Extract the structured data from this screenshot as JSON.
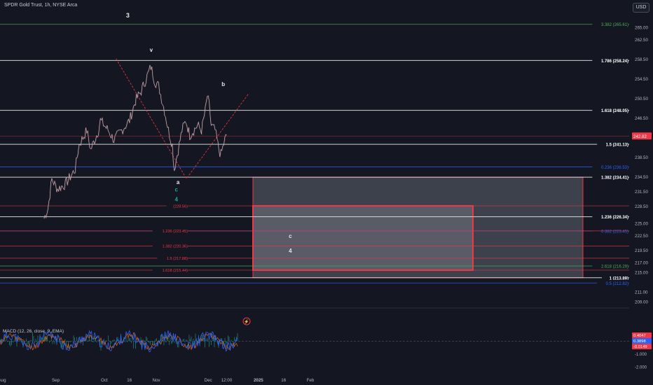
{
  "header": {
    "title": "SPDR Gold Trust, 1h, NYSE Arca",
    "currency": "USD"
  },
  "chart_data": {
    "type": "line",
    "y_axis": {
      "ticks": [
        "265.00",
        "262.50",
        "258.50",
        "254.50",
        "250.50",
        "246.50",
        "238.50",
        "234.50",
        "231.50",
        "228.50",
        "225.00",
        "222.50",
        "219.50",
        "217.00",
        "215.00",
        "211.00",
        "209.00"
      ],
      "current_price": "242.82",
      "range": [
        208,
        268
      ]
    },
    "x_axis": {
      "ticks": [
        "Aug",
        "Sep",
        "Oct",
        "16",
        "Nov",
        "Dec",
        "12:00",
        "2025",
        "16",
        "Feb"
      ]
    },
    "price_path": {
      "date_range": [
        "2024-08-26",
        "2024-12-20"
      ],
      "points": [
        [
          0,
          226
        ],
        [
          2,
          228
        ],
        [
          4,
          234
        ],
        [
          7,
          232
        ],
        [
          11,
          233
        ],
        [
          16,
          236
        ],
        [
          18,
          241
        ],
        [
          22,
          244
        ],
        [
          24,
          240
        ],
        [
          28,
          244
        ],
        [
          29,
          246
        ],
        [
          33,
          244
        ],
        [
          36,
          242
        ],
        [
          40,
          244
        ],
        [
          44,
          246
        ],
        [
          47,
          250
        ],
        [
          50,
          252
        ],
        [
          53,
          255
        ],
        [
          55,
          257
        ],
        [
          57,
          254
        ],
        [
          59,
          253
        ],
        [
          62,
          248
        ],
        [
          64,
          244
        ],
        [
          66,
          241
        ],
        [
          67,
          236
        ],
        [
          69,
          240
        ],
        [
          71,
          244
        ],
        [
          73,
          246
        ],
        [
          75,
          243
        ],
        [
          77,
          244
        ],
        [
          79,
          245
        ],
        [
          81,
          244
        ],
        [
          83,
          248
        ],
        [
          84,
          251
        ],
        [
          85,
          249
        ],
        [
          86,
          245
        ],
        [
          88,
          244
        ],
        [
          90,
          240
        ],
        [
          91,
          239
        ],
        [
          93,
          242
        ],
        [
          94,
          243
        ]
      ]
    },
    "price_levels": [
      {
        "label": "3.382 (265.61)",
        "value": 265.61,
        "color": "#4caf50"
      },
      {
        "label": "1.786 (258.24)",
        "value": 258.24,
        "color": "#e6e6e6"
      },
      {
        "label": "1.618 (248.05)",
        "value": 248.05,
        "color": "#e6e6e6"
      },
      {
        "label": "1.5 (241.13)",
        "value": 241.13,
        "color": "#e6e6e6"
      },
      {
        "label": "0.236 (236.53)",
        "value": 236.53,
        "color": "#2962ff"
      },
      {
        "label": "1.382 (234.41)",
        "value": 234.41,
        "color": "#e6e6e6"
      },
      {
        "label": "1.236 (226.34)",
        "value": 226.34,
        "color": "#e6e6e6"
      },
      {
        "label": "0.382 (223.45)",
        "value": 223.45,
        "color": "#2962ff"
      },
      {
        "label": "2.618 (216.29)",
        "value": 216.29,
        "color": "#4caf50"
      },
      {
        "label": "1 (213.89)",
        "value": 213.89,
        "color": "#e6e6e6"
      },
      {
        "label": "0.5 (212.82)",
        "value": 212.82,
        "color": "#2962ff"
      }
    ],
    "inner_fibs": [
      {
        "label": "(228.56)",
        "value": 228.56
      },
      {
        "label": "1.236 (223.45)",
        "value": 223.45
      },
      {
        "label": "1.382 (220.36)",
        "value": 220.36
      },
      {
        "label": "1.5 (217.88)",
        "value": 217.88
      },
      {
        "label": "1.618 (215.44)",
        "value": 215.44
      }
    ],
    "wave_labels": [
      {
        "text": "3",
        "date": "2024-10-15",
        "value": 267,
        "color": "#e6e6e6"
      },
      {
        "text": "v",
        "date": "2024-10-29",
        "value": 260,
        "color": "#e6e6e6"
      },
      {
        "text": "b",
        "date": "2024-12-11",
        "value": 253,
        "color": "#e6e6e6"
      },
      {
        "text": "a",
        "date": "2024-11-14",
        "value": 233,
        "color": "#e6e6e6"
      },
      {
        "text": "c",
        "date": "2024-11-13",
        "value": 231.5,
        "color": "#26a69a"
      },
      {
        "text": "4",
        "date": "2024-11-13",
        "value": 229.5,
        "color": "#26a69a"
      },
      {
        "text": "c",
        "date": "2025-01-20",
        "value": 222,
        "color": "#e6e6e6"
      },
      {
        "text": "4",
        "date": "2025-01-20",
        "value": 219,
        "color": "#e6e6e6"
      }
    ],
    "macd": {
      "label": "MACD (12, 26, close, 9, EMA)",
      "values": [
        "0.4047",
        "0.3898",
        "-0.0149"
      ],
      "ticks": [
        "-1.000",
        "-2.000"
      ],
      "range": [
        -2.6,
        1.6
      ]
    }
  },
  "colors": {
    "background": "#141722",
    "price": "#bcbfc7",
    "accent_red": "#f23645",
    "blue": "#2962ff",
    "green": "#4caf50",
    "macd": "#2962ff",
    "signal": "#ff6d00"
  }
}
